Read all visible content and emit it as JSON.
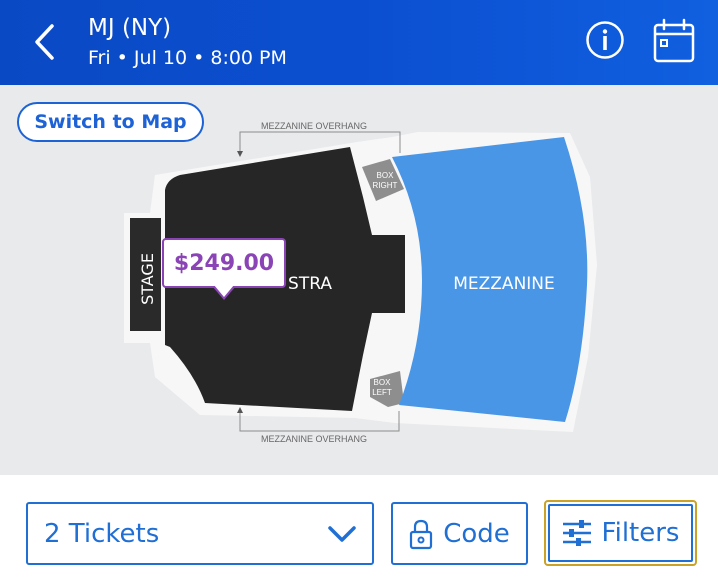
{
  "header": {
    "title": "MJ (NY)",
    "subtitle": "Fri • Jul 10 • 8:00 PM",
    "back_icon": "chevron-left-icon",
    "info_icon": "info-circle-icon",
    "calendar_icon": "calendar-icon"
  },
  "map": {
    "switch_label": "Switch to Map",
    "stage_label": "STAGE",
    "orchestra_label": "STRA",
    "mezzanine_label": "MEZZANINE",
    "box_right_label_1": "BOX",
    "box_right_label_2": "RIGHT",
    "box_left_label_1": "BOX",
    "box_left_label_2": "LEFT",
    "overhang_top": "MEZZANINE OVERHANG",
    "overhang_bottom": "MEZZANINE OVERHANG",
    "price": "$249.00"
  },
  "bottom": {
    "tickets_label": "2 Tickets",
    "code_label": "Code",
    "filters_label": "Filters"
  },
  "colors": {
    "header_blue": "#0b4fd0",
    "accent_blue": "#1f6fd4",
    "mezzanine_blue": "#4a96e6",
    "orchestra_dark": "#262626",
    "price_purple": "#8a44b5",
    "focus_gold": "#c9a227"
  }
}
